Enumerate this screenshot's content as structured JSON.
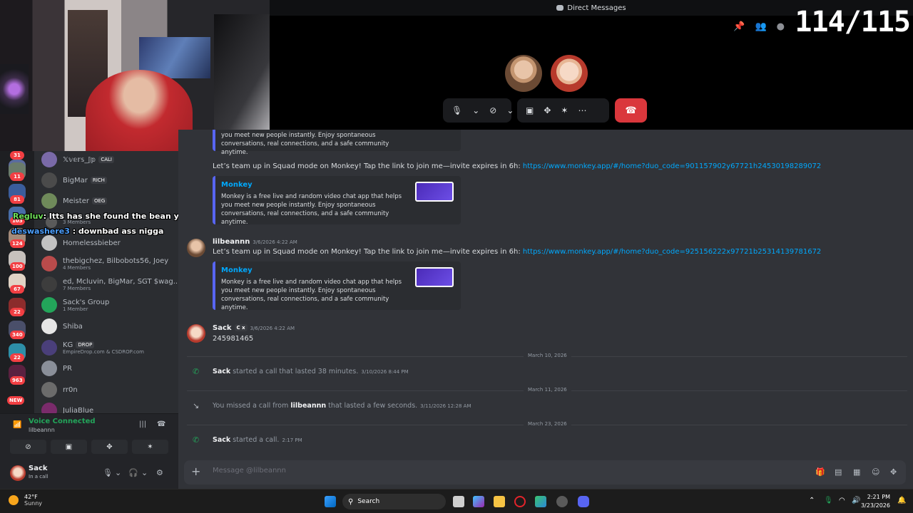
{
  "stream": {
    "counter": "114/115"
  },
  "titlebar": {
    "title": "Direct Messages"
  },
  "dm_list": [
    {
      "name": "𝕏𝕧𝕖𝕣𝕤_𝕁𝕡",
      "tag": "CALI",
      "sub": ""
    },
    {
      "name": "BigMar",
      "tag": "RICH",
      "sub": ""
    },
    {
      "name": "Meister",
      "tag": "OEG",
      "sub": ""
    },
    {
      "name": "",
      "tag": "",
      "sub": "3 Members"
    },
    {
      "name": "Homelessbieber",
      "tag": "",
      "sub": ""
    },
    {
      "name": "thebigchez, Bilbobots56, Joey",
      "tag": "",
      "sub": "4 Members"
    },
    {
      "name": "ed, Mcluvin, BigMar, SGT $wag...",
      "tag": "",
      "sub": "7 Members"
    },
    {
      "name": "Sack's Group",
      "tag": "",
      "sub": "1 Member"
    },
    {
      "name": "Shiba",
      "tag": "",
      "sub": ""
    },
    {
      "name": "KG",
      "tag": "DROP",
      "sub": "EmpireDrop.com & CSDROP.com"
    },
    {
      "name": "PR",
      "tag": "",
      "sub": ""
    },
    {
      "name": "rr0n",
      "tag": "",
      "sub": ""
    },
    {
      "name": "JuliaBlue",
      "tag": "",
      "sub": ""
    }
  ],
  "server_badges": [
    "31",
    "11",
    "81",
    "103",
    "124",
    "100",
    "67",
    "22",
    "340",
    "22",
    "963",
    "NEW"
  ],
  "stream_chat": [
    {
      "user": "Regluv",
      "text": ": Itts has she found the bean yet?"
    },
    {
      "user": "deswashere3",
      "text": " : downbad ass nigga"
    }
  ],
  "voice": {
    "status": "Voice Connected",
    "channel": "lilbeannn"
  },
  "user": {
    "name": "Sack",
    "status": "In a call"
  },
  "messages": {
    "top_embed_desc": "Monkey is a free live and random video chat app that helps you meet new people instantly. Enjoy spontaneous conversations, real connections, and a safe community anytime.",
    "msg1_text": "Let’s team up in Squad mode on Monkey! Tap the link to join me—invite expires in 6h: ",
    "msg1_link": "https://www.monkey.app/#/home?duo_code=901157902y67721h24530198289072",
    "embed_title": "Monkey",
    "embed_desc": "Monkey is a free live and random video chat app that helps you meet new people instantly. Enjoy spontaneous conversations, real connections, and a safe community anytime.",
    "msg2_author": "lilbeannn",
    "msg2_time": "3/6/2026 4:22 AM",
    "msg2_text": "Let’s team up in Squad mode on Monkey! Tap the link to join me—invite expires in 6h: ",
    "msg2_link": "https://www.monkey.app/#/home?duo_code=925156222x97721b25314139781672",
    "msg3_author": "Sack",
    "msg3_tag": "C x",
    "msg3_time": "3/6/2026 4:22 AM",
    "msg3_text": "245981465",
    "div1": "March 10, 2026",
    "call1_user": "Sack",
    "call1_text": " started a call that lasted 38 minutes.",
    "call1_time": "3/10/2026 8:44 PM",
    "div2": "March 11, 2026",
    "call2_text": "You missed a call from ",
    "call2_user": "lilbeannn",
    "call2_text2": " that lasted a few seconds.",
    "call2_time": "3/11/2026 12:28 AM",
    "div3": "March 23, 2026",
    "call3_user": "Sack",
    "call3_text": " started a call.",
    "call3_time": "2:17 PM"
  },
  "composer": {
    "placeholder": "Message @lilbeannn"
  },
  "taskbar": {
    "temp": "42°F",
    "weather": "Sunny",
    "search": "Search",
    "time": "2:21 PM",
    "date": "3/23/2026"
  },
  "colors": {
    "accent": "#5865f2",
    "hangup": "#da373c",
    "online": "#23a55a",
    "link": "#00a8fc"
  }
}
